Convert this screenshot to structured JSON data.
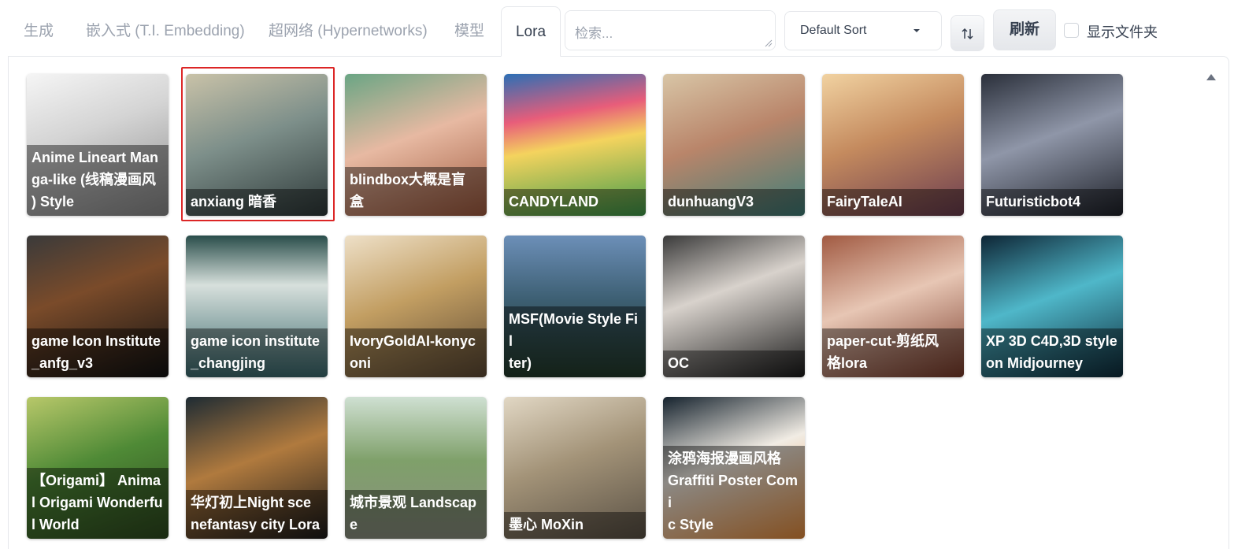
{
  "tabs": [
    {
      "label": "生成"
    },
    {
      "label": "嵌入式 (T.I. Embedding)"
    },
    {
      "label": "超网络 (Hypernetworks)"
    },
    {
      "label": "模型"
    },
    {
      "label": "Lora"
    }
  ],
  "active_tab": "Lora",
  "search": {
    "placeholder": "检索..."
  },
  "sort": {
    "selected": "Default Sort"
  },
  "refresh_label": "刷新",
  "show_folders_label": "显示文件夹",
  "cards": [
    {
      "name": "Anime Lineart Manga-like (线稿漫画风) Style",
      "caption_lines": [
        "Anime Lineart Man",
        "ga-like (线稿漫画风",
        ") Style"
      ]
    },
    {
      "name": "anxiang 暗香",
      "caption_lines": [
        "anxiang 暗香"
      ]
    },
    {
      "name": "blindbox大概是盲盒",
      "caption_lines": [
        "blindbox大概是盲",
        "盒"
      ]
    },
    {
      "name": "CANDYLAND",
      "caption_lines": [
        "CANDYLAND"
      ]
    },
    {
      "name": "dunhuangV3",
      "caption_lines": [
        "dunhuangV3"
      ]
    },
    {
      "name": "FairyTaleAI",
      "caption_lines": [
        "FairyTaleAI"
      ]
    },
    {
      "name": "Futuristicbot4",
      "caption_lines": [
        "Futuristicbot4"
      ]
    },
    {
      "name": "game Icon Institute_anfg_v3",
      "caption_lines": [
        "game Icon Institute",
        "_anfg_v3"
      ]
    },
    {
      "name": "game icon institute_changjing",
      "caption_lines": [
        "game icon institute",
        "_changjing"
      ]
    },
    {
      "name": "IvoryGoldAI-konyconi",
      "caption_lines": [
        "IvoryGoldAI-konyc",
        "oni"
      ]
    },
    {
      "name": "MSF(Movie Style Filter)",
      "caption_lines": [
        "MSF(Movie Style Fil",
        "ter)"
      ]
    },
    {
      "name": "OC",
      "caption_lines": [
        "OC"
      ]
    },
    {
      "name": "paper-cut-剪纸风格lora",
      "caption_lines": [
        "paper-cut-剪纸风",
        "格lora"
      ]
    },
    {
      "name": "XP 3D C4D,3D style on Midjourney",
      "caption_lines": [
        "XP 3D C4D,3D style",
        "on Midjourney"
      ]
    },
    {
      "name": "【Origami】 Animal Origami Wonderful World",
      "caption_lines": [
        "【Origami】 Anima",
        "l Origami Wonderfu",
        "l World"
      ]
    },
    {
      "name": "华灯初上Night scenefantasy city Lora",
      "caption_lines": [
        "华灯初上Night sce",
        "nefantasy city Lora"
      ]
    },
    {
      "name": "城市景观 Landscape",
      "caption_lines": [
        "城市景观 Landscap",
        "e"
      ]
    },
    {
      "name": "墨心 MoXin",
      "caption_lines": [
        "墨心 MoXin"
      ]
    },
    {
      "name": "涂鸦海报漫画风格Graffiti Poster Comic Style",
      "caption_lines": [
        "涂鸦海报漫画风格",
        "Graffiti Poster Comi",
        "c Style"
      ]
    }
  ],
  "selected_card": "anxiang 暗香",
  "colors": {
    "selection_border": "#dc2626",
    "caption_bg": "rgba(0,0,0,0.42)"
  }
}
